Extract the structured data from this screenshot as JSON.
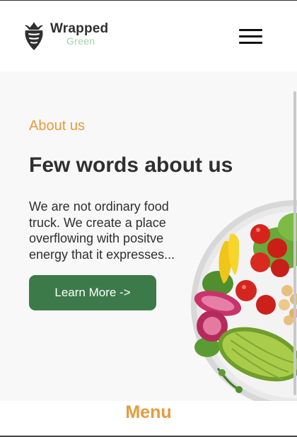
{
  "header": {
    "logo_word": "Wrapped",
    "logo_sub": "Green",
    "menu_icon": "hamburger-icon"
  },
  "about": {
    "eyebrow": "About us",
    "heading": "Few words about us",
    "description": "We are not ordinary food truck. We create a place overflowing with positve energy that it expresses...",
    "cta_label": "Learn More ->"
  },
  "menu_section": {
    "title": "Menu"
  },
  "colors": {
    "accent": "#e79a3c",
    "button": "#3d7a4a",
    "logo_sub": "#9ed7a7",
    "text": "#2f2f2f"
  }
}
